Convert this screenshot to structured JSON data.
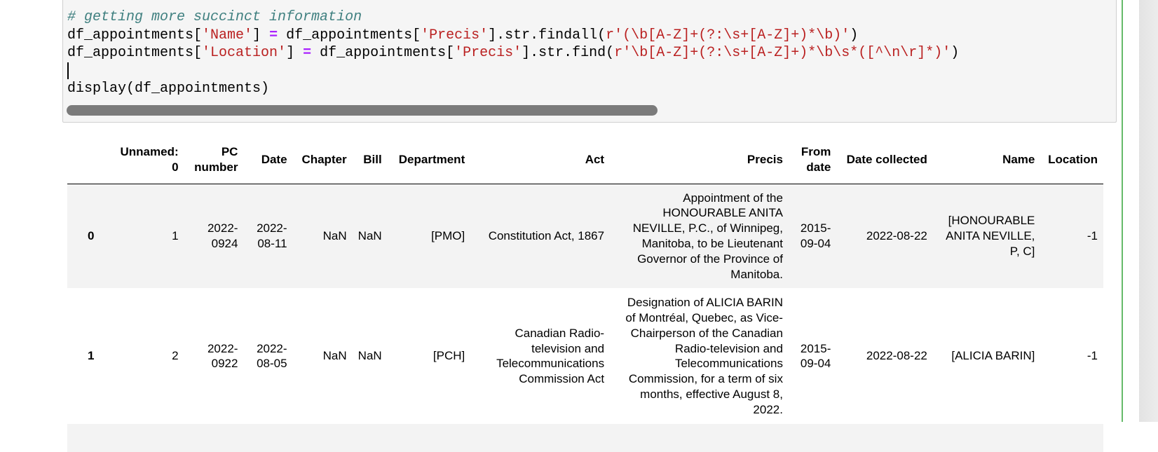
{
  "code_cell": {
    "lines": [
      {
        "tokens": [
          {
            "type": "comment",
            "text": "# getting more succinct information"
          }
        ]
      },
      {
        "tokens": [
          {
            "type": "plain",
            "text": "df_appointments["
          },
          {
            "type": "string",
            "text": "'Name'"
          },
          {
            "type": "plain",
            "text": "] "
          },
          {
            "type": "op",
            "text": "="
          },
          {
            "type": "plain",
            "text": " df_appointments["
          },
          {
            "type": "string",
            "text": "'Precis'"
          },
          {
            "type": "plain",
            "text": "].str.findall("
          },
          {
            "type": "string",
            "text": "r'(\\b[A-Z]+(?:\\s+[A-Z]+)*\\b)'"
          },
          {
            "type": "plain",
            "text": ")"
          }
        ]
      },
      {
        "tokens": [
          {
            "type": "plain",
            "text": "df_appointments["
          },
          {
            "type": "string",
            "text": "'Location'"
          },
          {
            "type": "plain",
            "text": "] "
          },
          {
            "type": "op",
            "text": "="
          },
          {
            "type": "plain",
            "text": " df_appointments["
          },
          {
            "type": "string",
            "text": "'Precis'"
          },
          {
            "type": "plain",
            "text": "].str.find("
          },
          {
            "type": "string",
            "text": "r'\\b[A-Z]+(?:\\s+[A-Z]+)*\\b\\s*([^\\n\\r]*)'"
          },
          {
            "type": "plain",
            "text": ")"
          }
        ]
      },
      {
        "tokens": [
          {
            "type": "cursor",
            "text": ""
          }
        ]
      },
      {
        "tokens": [
          {
            "type": "plain",
            "text": "display(df_appointments)"
          }
        ]
      }
    ],
    "horizontal_scroll_fraction_visible": 0.56,
    "colors": {
      "comment": "#408080",
      "string": "#ba2121",
      "operator": "#aa22ff",
      "background": "#f5f5f5",
      "scrollbar_thumb": "#7b7b7b"
    }
  },
  "output_table": {
    "columns": [
      {
        "key": "index",
        "label": ""
      },
      {
        "key": "unnamed",
        "label": "Unnamed: 0"
      },
      {
        "key": "pc_number",
        "label": "PC number"
      },
      {
        "key": "date",
        "label": "Date"
      },
      {
        "key": "chapter",
        "label": "Chapter"
      },
      {
        "key": "bill",
        "label": "Bill"
      },
      {
        "key": "department",
        "label": "Department"
      },
      {
        "key": "act",
        "label": "Act"
      },
      {
        "key": "precis",
        "label": "Precis"
      },
      {
        "key": "from_date",
        "label": "From date"
      },
      {
        "key": "date_collected",
        "label": "Date collected"
      },
      {
        "key": "name",
        "label": "Name"
      },
      {
        "key": "location",
        "label": "Location"
      }
    ],
    "rows": [
      {
        "index": "0",
        "unnamed": "1",
        "pc_number": "2022-0924",
        "date": "2022-08-11",
        "chapter": "NaN",
        "bill": "NaN",
        "department": "[PMO]",
        "act": "Constitution Act, 1867",
        "precis": "Appointment of the HONOURABLE ANITA NEVILLE, P.C., of Winnipeg, Manitoba, to be Lieutenant Governor of the Province of Manitoba.",
        "from_date": "2015-09-04",
        "date_collected": "2022-08-22",
        "name": "[HONOURABLE ANITA NEVILLE, P, C]",
        "location": "-1"
      },
      {
        "index": "1",
        "unnamed": "2",
        "pc_number": "2022-0922",
        "date": "2022-08-05",
        "chapter": "NaN",
        "bill": "NaN",
        "department": "[PCH]",
        "act": "Canadian Radio-television and Telecommunications Commission Act",
        "precis": "Designation of ALICIA BARIN of Montréal, Quebec, as Vice-Chairperson of the Canadian Radio-television and Telecommunications Commission, for a term of six months, effective August 8, 2022.",
        "from_date": "2015-09-04",
        "date_collected": "2022-08-22",
        "name": "[ALICIA BARIN]",
        "location": "-1"
      }
    ],
    "colors": {
      "odd_row": "#f3f3f3",
      "even_row": "#ffffff",
      "header_rule": "#000000"
    }
  },
  "cell_state": {
    "selected_edit_mode_border_color": "#66bb6a"
  }
}
